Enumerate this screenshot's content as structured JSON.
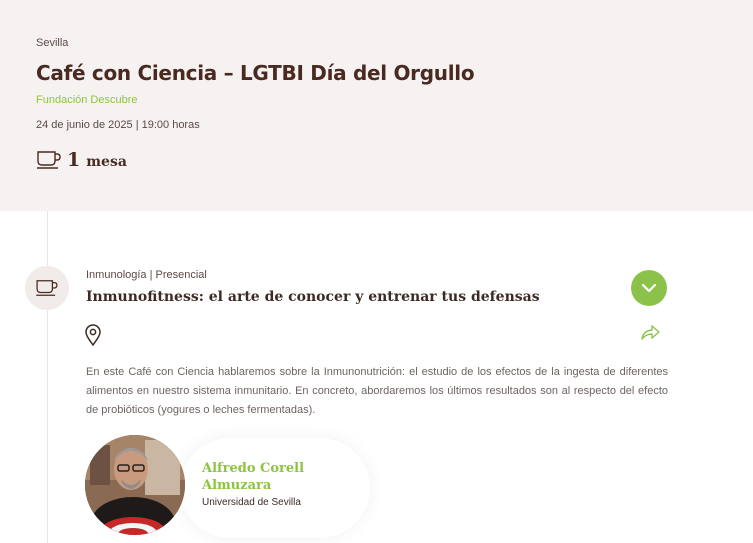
{
  "event": {
    "city": "Sevilla",
    "title": "Café con Ciencia – LGTBI Día del Orgullo",
    "organizer": "Fundación Descubre",
    "datetime": "24 de junio de 2025 | 19:00 horas",
    "table_count": "1",
    "table_label": "mesa",
    "table_icon": "coffee-cup-icon"
  },
  "session": {
    "category": "Inmunología | Presencial",
    "title": "Inmunofitness: el arte de conocer y entrenar tus defensas",
    "description": "En este Café con Ciencia hablaremos sobre la Inmunonutrición: el estudio de los efectos de la ingesta de diferentes alimentos en nuestro sistema inmunitario. En concreto, abordaremos los últimos resultados son al respecto del efecto de probióticos (yogures o leches fermentadas).",
    "icons": {
      "node": "coffee-cup-icon",
      "expand": "chevron-down-icon",
      "share": "share-icon",
      "location": "location-pin-icon"
    }
  },
  "speaker": {
    "name": "Alfredo Corell Almuzara",
    "affiliation": "Universidad de Sevilla"
  },
  "colors": {
    "accent_green": "#8bc34a",
    "header_bg": "#f6f2f1",
    "title_brown": "#4a2a20"
  }
}
